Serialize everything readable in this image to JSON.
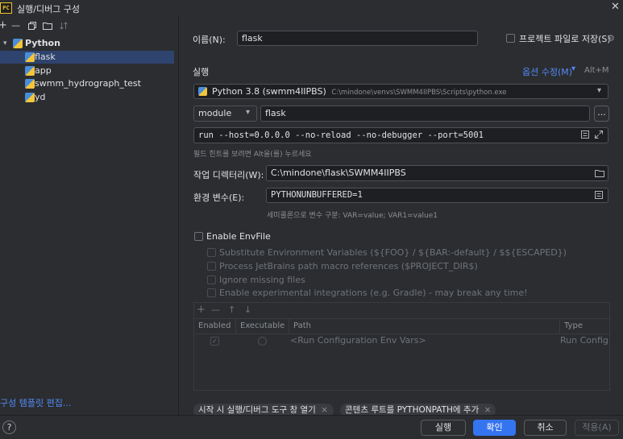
{
  "window": {
    "app_icon": "PC",
    "title": "실행/디버그 구성",
    "close": "✕"
  },
  "left_toolbar": {
    "add": "+",
    "remove": "—",
    "copy_icon": "copy-icon",
    "folder_icon": "folder-icon",
    "sort_icon": "sort-icon"
  },
  "tree": {
    "group": {
      "label": "Python",
      "expanded": true
    },
    "items": [
      {
        "label": "flask",
        "selected": true
      },
      {
        "label": "app",
        "selected": false
      },
      {
        "label": "swmm_hydrograph_test",
        "selected": false
      },
      {
        "label": "yd",
        "selected": false
      }
    ]
  },
  "edit_templates_link": "구성 템플릿 편집...",
  "form": {
    "name_label": "이름(N):",
    "name_value": "flask",
    "store_as_file_label": "프로젝트 파일로 저장(S)",
    "store_as_file_checked": false,
    "section_run": "실행",
    "modify_options": "옵션 수정(M)",
    "modify_shortcut": "Alt+M",
    "interpreter_name": "Python 3.8 (swmm4IIPBS)",
    "interpreter_path": "C:\\mindone\\venvs\\SWMM4IIPBS\\Scripts\\python.exe",
    "target_type": "module",
    "target_value": "flask",
    "browse": "...",
    "parameters": "run --host=0.0.0.0 --no-reload --no-debugger --port=5001",
    "parameters_hint": "필드 힌트를 보려면 Alt을(를) 누르세요",
    "workdir_label": "작업 디렉터리(W):",
    "workdir_value": "C:\\mindone\\flask\\SWMM4IIPBS",
    "env_label": "환경 변수(E):",
    "env_value": "PYTHONUNBUFFERED=1",
    "env_hint": "세미콜론으로 변수 구분: VAR=value; VAR1=value1"
  },
  "envfile": {
    "enable_label": "Enable EnvFile",
    "enabled": false,
    "options": [
      "Substitute Environment Variables (${FOO} / ${BAR:-default} / $${ESCAPED})",
      "Process JetBrains path macro references ($PROJECT_DIR$)",
      "Ignore missing files",
      "Enable experimental integrations (e.g. Gradle) - may break any time!"
    ],
    "toolbar": [
      "+",
      "—",
      "↑",
      "↓"
    ],
    "columns": [
      "Enabled",
      "Executable",
      "Path",
      "Type"
    ],
    "rows": [
      {
        "enabled": true,
        "executable": false,
        "path": "<Run Configuration Env Vars>",
        "type": "Run Config"
      }
    ]
  },
  "tags": [
    {
      "label": "시작 시 실행/디버그 도구 창 열기"
    },
    {
      "label": "콘텐츠 루트를 PYTHONPATH에 추가"
    }
  ],
  "buttons": {
    "help": "?",
    "run": "실행",
    "ok": "확인",
    "cancel": "취소",
    "apply": "적용(A)"
  },
  "colors": {
    "background": "#2b2d30",
    "accent": "#3574f0",
    "selection": "#2e436e",
    "link": "#548af7",
    "field_bg": "#1e1f22"
  }
}
